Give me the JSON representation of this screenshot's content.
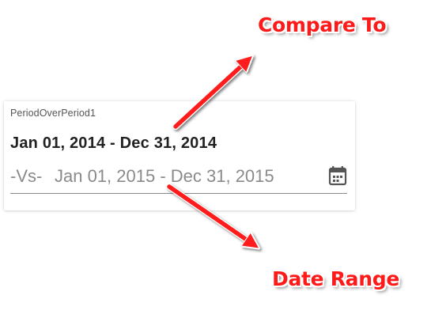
{
  "widget": {
    "title": "PeriodOverPeriod1",
    "date_range": "Jan 01, 2014 - Dec 31, 2014",
    "vs_label": "-Vs-",
    "compare_range": "Jan 01, 2015 - Dec 31, 2015",
    "calendar_icon": "calendar-icon"
  },
  "annotations": {
    "compare_to": "Compare To",
    "date_range": "Date Range",
    "color": "#ff1a1a"
  }
}
